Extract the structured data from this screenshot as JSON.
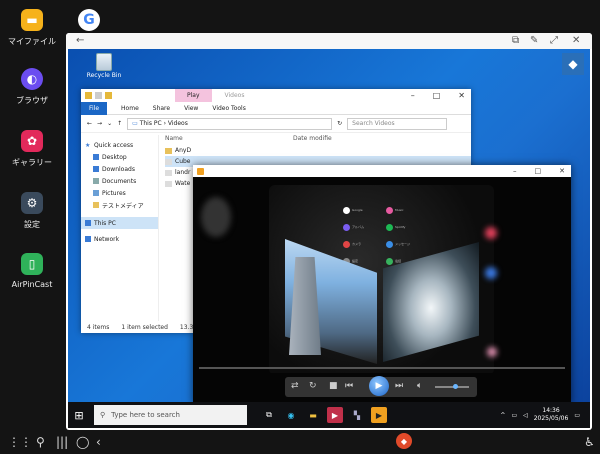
{
  "launcher": {
    "apps": [
      {
        "label": "マイファイル",
        "icon": "folder-icon",
        "color": "#f6b21b"
      },
      {
        "label": "",
        "icon": "google-icon",
        "color": "#ffffff"
      },
      {
        "label": "ブラウザ",
        "icon": "browser-icon",
        "color": "#6b4df0"
      },
      {
        "label": "ギャラリー",
        "icon": "gallery-icon",
        "color": "#e2295b"
      },
      {
        "label": "設定",
        "icon": "gear-icon",
        "color": "#3a4a5c"
      },
      {
        "label": "AirPinCast",
        "icon": "airpincast-icon",
        "color": "#2fb25a"
      }
    ]
  },
  "desktop": {
    "recycle_bin_label": "Recycle Bin"
  },
  "explorer": {
    "play_tab": "Play",
    "title": "Videos",
    "ribbon": [
      "File",
      "Home",
      "Share",
      "View",
      "Video Tools"
    ],
    "path": [
      "This PC",
      "Videos"
    ],
    "search_placeholder": "Search Videos",
    "columns": [
      "Name",
      "Date modifie"
    ],
    "sidebar": [
      {
        "label": "Quick access"
      },
      {
        "label": "Desktop"
      },
      {
        "label": "Downloads"
      },
      {
        "label": "Documents"
      },
      {
        "label": "Pictures"
      },
      {
        "label": "テストメディア"
      },
      {
        "label": "This PC"
      },
      {
        "label": "Network"
      }
    ],
    "files": [
      "AnyD",
      "Cube",
      "landr",
      "Wate"
    ],
    "status": {
      "items": "4 items",
      "selected": "1 item selected",
      "size": "13.3 MB"
    }
  },
  "player": {
    "apps": [
      "Google",
      "Music",
      "アルバム",
      "Spotify",
      "カメラ",
      "メッセージ",
      "設定",
      "電話"
    ]
  },
  "taskbar": {
    "search_placeholder": "Type here to search",
    "time": "14:36",
    "date": "2025/05/06"
  }
}
